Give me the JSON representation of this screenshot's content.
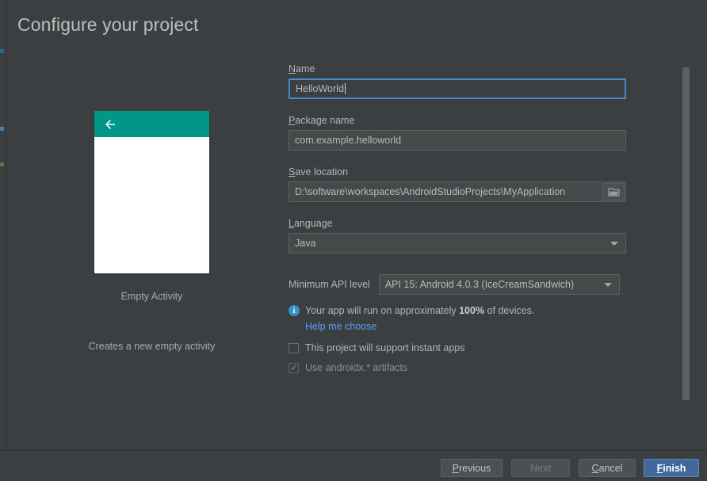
{
  "dialog": {
    "title": "Configure your project"
  },
  "preview": {
    "back_icon": "back-arrow-icon",
    "activity_name": "Empty Activity",
    "activity_description": "Creates a new empty activity",
    "app_bar_color": "#009688",
    "body_color": "#ffffff"
  },
  "form": {
    "name": {
      "label_prefix": "",
      "label_mnemonic": "N",
      "label_rest": "ame",
      "label_full": "Name",
      "value": "HelloWorld",
      "focused": true
    },
    "package_name": {
      "label_mnemonic": "P",
      "label_rest": "ackage name",
      "label_full": "Package name",
      "value": "com.example.helloworld"
    },
    "save_location": {
      "label_mnemonic": "S",
      "label_rest": "ave location",
      "label_full": "Save location",
      "value": "D:\\software\\workspaces\\AndroidStudioProjects\\MyApplication",
      "browse_icon": "folder-icon"
    },
    "language": {
      "label_mnemonic": "L",
      "label_rest": "anguage",
      "label_full": "Language",
      "value": "Java"
    },
    "min_api": {
      "label": "Minimum API level",
      "value": "API 15: Android 4.0.3 (IceCreamSandwich)"
    },
    "info": {
      "icon": "info-icon",
      "text_before": "Your app will run on approximately ",
      "percent": "100%",
      "text_after": " of devices.",
      "link_label": "Help me choose",
      "link_color": "#589df6"
    },
    "instant_apps": {
      "label": "This project will support instant apps",
      "checked": false
    },
    "androidx": {
      "label": "Use androidx.* artifacts",
      "checked": true,
      "disabled": true
    }
  },
  "footer": {
    "previous": {
      "mnemonic": "P",
      "rest": "revious",
      "full": "Previous",
      "enabled": true
    },
    "next": {
      "full": "Next",
      "enabled": false
    },
    "cancel": {
      "mnemonic": "C",
      "rest": "ancel",
      "full": "Cancel",
      "enabled": true
    },
    "finish": {
      "mnemonic": "F",
      "rest": "inish",
      "full": "Finish",
      "enabled": true,
      "primary": true,
      "color": "#41689c"
    }
  },
  "scrollbar": {
    "name": "vertical-scrollbar"
  }
}
